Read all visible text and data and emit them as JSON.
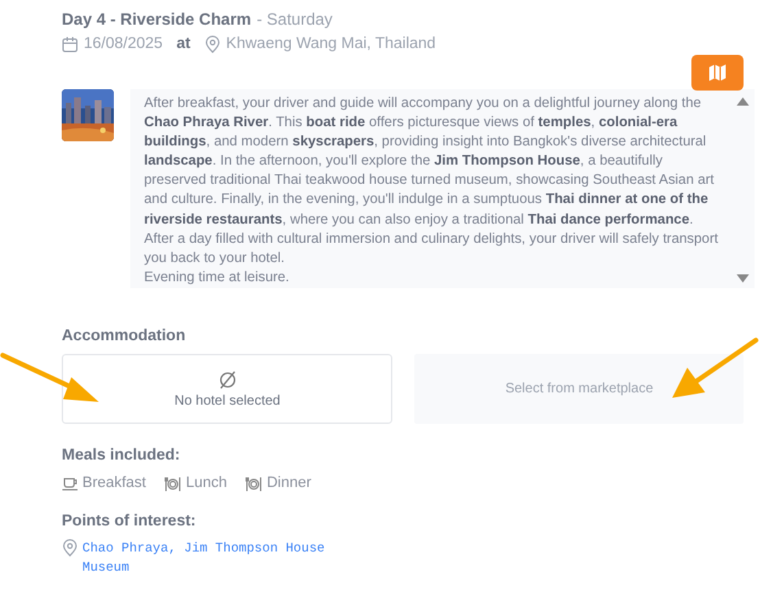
{
  "day": {
    "title": "Day 4 - Riverside Charm",
    "weekday": "- Saturday",
    "date": "16/08/2025",
    "at": "at",
    "location": "Khwaeng Wang Mai, Thailand"
  },
  "description": [
    "After breakfast, your driver and guide will accompany you on a delightful journey along the **Chao Phraya River**. This **boat ride** offers picturesque views of **temples**, **colonial-era buildings**, and modern **skyscrapers**, providing insight into Bangkok's diverse architectural **landscape**. In the afternoon, you'll explore the **Jim Thompson House**, a beautifully preserved traditional Thai teakwood house turned museum, showcasing Southeast Asian art and culture. Finally, in the evening, you'll indulge in a sumptuous **Thai dinner at one of the riverside restaurants**, where you can also enjoy a traditional **Thai dance performance**. After a day filled with cultural immersion and culinary delights, your driver will safely transport you back to your hotel.",
    "Evening time at leisure."
  ],
  "accommodation": {
    "heading": "Accommodation",
    "empty_text": "No hotel selected",
    "marketplace_button": "Select from marketplace"
  },
  "meals": {
    "heading": "Meals included:",
    "items": [
      {
        "kind": "cup",
        "label": "Breakfast"
      },
      {
        "kind": "plate",
        "label": "Lunch"
      },
      {
        "kind": "plate",
        "label": "Dinner"
      }
    ]
  },
  "points": {
    "heading": "Points of interest:",
    "link": "Chao Phraya, Jim Thompson House Museum"
  }
}
